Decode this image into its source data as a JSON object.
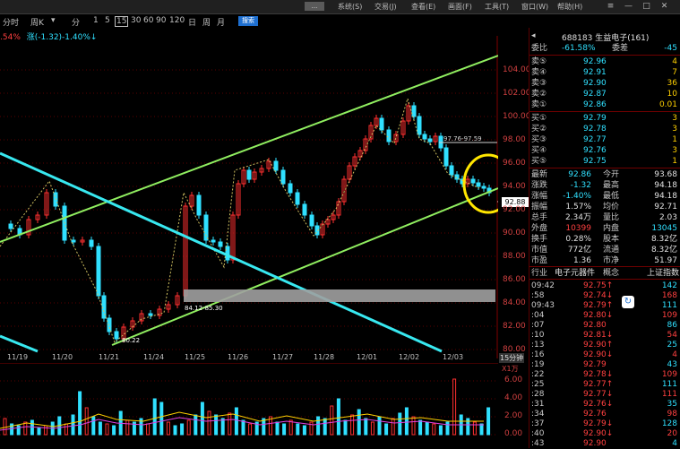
{
  "menu": {
    "items": [
      "系统(S)",
      "交易(J)",
      "查看(E)",
      "画面(F)",
      "工具(T)",
      "窗口(W)",
      "帮助(H)"
    ],
    "tag": "..."
  },
  "toolbar": {
    "lead": "分时",
    "mode": "周K",
    "periods": [
      "1",
      "5",
      "15",
      "30",
      "60",
      "90",
      "120",
      "日",
      "周",
      "月"
    ],
    "active_period": "15",
    "search_label": "搜索"
  },
  "change_line": {
    "left_pct": ".54%",
    "detail": "涨(-1.32)-1.40%↓"
  },
  "chart": {
    "price_ticks": [
      "104.00",
      "102.00",
      "100.00",
      "98.00",
      "96.00",
      "94.00",
      "92.00",
      "90.00",
      "88.00",
      "86.00",
      "84.00",
      "82.00",
      "80.00"
    ],
    "dates": [
      "11/19",
      "11/20",
      "11/21",
      "11/24",
      "11/25",
      "11/26",
      "11/27",
      "11/28",
      "12/01",
      "12/02",
      "12/03"
    ],
    "period_label": "15分钟",
    "annotation_high": "97.76-97.59",
    "annotation_box": "84.12-85.30",
    "annotation_low": "80.22",
    "current_price_tag": "92.88",
    "vol_unit": "X1万",
    "vol_ticks": [
      "6.00",
      "4.00",
      "2.00",
      "0.00"
    ],
    "colors": {
      "up": "#ff3030",
      "down": "#30e0ff",
      "channel": "#90ee60",
      "trend": "#38e8f0",
      "highlight": "#ffe600"
    }
  },
  "panel": {
    "stock_title": "688183 生益电子(161)",
    "order_ratio": {
      "label": "委比",
      "value": "-61.58%",
      "label2": "委差",
      "value2": "-45"
    },
    "asks": [
      {
        "label": "卖⑤",
        "price": "92.96",
        "vol": "4"
      },
      {
        "label": "卖④",
        "price": "92.91",
        "vol": "7"
      },
      {
        "label": "卖③",
        "price": "92.90",
        "vol": "36"
      },
      {
        "label": "卖②",
        "price": "92.87",
        "vol": "10"
      },
      {
        "label": "卖①",
        "price": "92.86",
        "vol": "0.01"
      }
    ],
    "bids": [
      {
        "label": "买①",
        "price": "92.79",
        "vol": "3"
      },
      {
        "label": "买②",
        "price": "92.78",
        "vol": "3"
      },
      {
        "label": "买③",
        "price": "92.77",
        "vol": "1"
      },
      {
        "label": "买④",
        "price": "92.76",
        "vol": "3"
      },
      {
        "label": "买⑤",
        "price": "92.75",
        "vol": "1"
      }
    ],
    "stats": [
      {
        "l1": "最新",
        "v1": "92.86",
        "l2": "今开",
        "v2": "93.68"
      },
      {
        "l1": "涨跌",
        "v1": "-1.32",
        "l2": "最高",
        "v2": "94.18"
      },
      {
        "l1": "涨幅",
        "v1": "-1.40%",
        "l2": "最低",
        "v2": "94.18"
      },
      {
        "l1": "振幅",
        "v1": "1.57%",
        "l2": "均价",
        "v2": "92.71"
      },
      {
        "l1": "总手",
        "v1": "2.34万",
        "l2": "量比",
        "v2": "2.03"
      },
      {
        "l1": "外盘",
        "v1": "10399",
        "l2": "内盘",
        "v2": "13045"
      },
      {
        "l1": "换手",
        "v1": "0.28%",
        "l2": "股本",
        "v2": "8.32亿"
      },
      {
        "l1": "市值",
        "v1": "772亿",
        "l2": "流通",
        "v2": "8.32亿"
      },
      {
        "l1": "市盈",
        "v1": "1.36",
        "l2": "市净",
        "v2": "51.97"
      }
    ],
    "industry": {
      "l1": "行业",
      "v1": "电子元器件",
      "l2": "概念",
      "v2": "上证指数"
    },
    "ticks": [
      {
        "t": "09:42",
        "p": "92.75↑",
        "v": "142"
      },
      {
        "t": ":58",
        "p": "92.74↓",
        "v": "168"
      },
      {
        "t": "09:43",
        "p": "92.79↑",
        "v": "111"
      },
      {
        "t": ":04",
        "p": "92.80↓",
        "v": "109"
      },
      {
        "t": ":07",
        "p": "92.80",
        "v": "86"
      },
      {
        "t": ":10",
        "p": "92.81↓",
        "v": "54"
      },
      {
        "t": ":13",
        "p": "92.90↑",
        "v": "25"
      },
      {
        "t": ":16",
        "p": "92.90↓",
        "v": "4"
      },
      {
        "t": ":19",
        "p": "92.79",
        "v": "43"
      },
      {
        "t": ":22",
        "p": "92.78↓",
        "v": "109"
      },
      {
        "t": ":25",
        "p": "92.77↑",
        "v": "111"
      },
      {
        "t": ":28",
        "p": "92.77↓",
        "v": "111"
      },
      {
        "t": ":31",
        "p": "92.76↓",
        "v": "35"
      },
      {
        "t": ":34",
        "p": "92.76",
        "v": "98"
      },
      {
        "t": ":37",
        "p": "92.79↓",
        "v": "128"
      },
      {
        "t": ":40",
        "p": "92.90↓",
        "v": "20"
      },
      {
        "t": ":43",
        "p": "92.90",
        "v": "4"
      }
    ]
  }
}
